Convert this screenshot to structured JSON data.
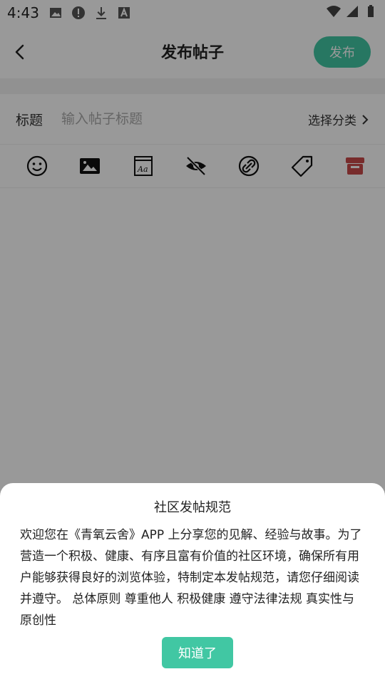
{
  "status_bar": {
    "time": "4:43",
    "icons_left": [
      "image-icon",
      "alert-icon",
      "download-icon",
      "a-box-icon"
    ],
    "icons_right": [
      "wifi-icon",
      "signal-icon",
      "battery-icon"
    ]
  },
  "header": {
    "title": "发布帖子",
    "publish_label": "发布"
  },
  "title_row": {
    "label": "标题",
    "placeholder": "输入帖子标题",
    "category_label": "选择分类"
  },
  "toolbar": {
    "items": [
      "emoji-icon",
      "image-icon",
      "font-icon",
      "hide-icon",
      "link-icon",
      "tag-icon",
      "shop-icon"
    ],
    "accent_color": "#c94a4a"
  },
  "modal": {
    "title": "社区发帖规范",
    "body": "欢迎您在《青氧云舍》APP 上分享您的见解、经验与故事。为了营造一个积极、健康、有序且富有价值的社区环境，确保所有用户能够获得良好的浏览体验，特制定本发帖规范，请您仔细阅读并遵守。 总体原则 尊重他人 积极健康 遵守法律法规 真实性与原创性",
    "ok_label": "知道了"
  },
  "colors": {
    "brand": "#41c7a3",
    "overlay": "rgba(0,0,0,0.4)"
  }
}
